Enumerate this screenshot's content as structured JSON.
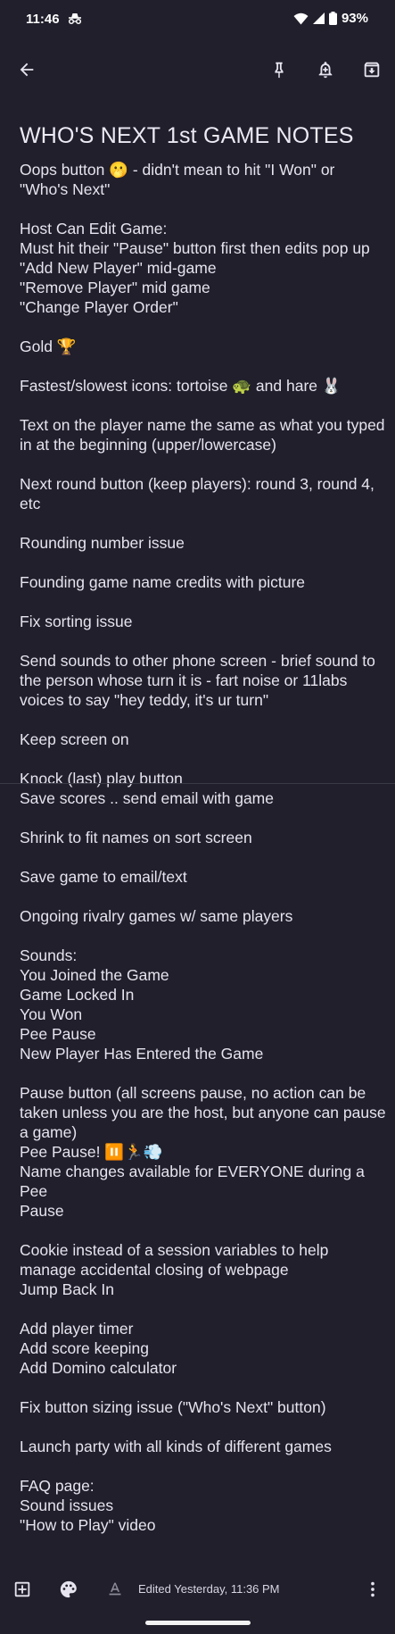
{
  "status": {
    "time": "11:46",
    "battery": "93%"
  },
  "note": {
    "title": "WHO'S NEXT 1st GAME NOTES",
    "blocks": [
      [
        "Oops button 🫢 - didn't mean to hit \"I Won\" or",
        "\"Who's Next\""
      ],
      [
        "Host Can Edit Game:",
        "Must hit their \"Pause\" button first then edits pop up",
        "\"Add New Player\" mid-game",
        "\"Remove Player\" mid game",
        "\"Change Player Order\""
      ],
      [
        "Gold 🏆"
      ],
      [
        "Fastest/slowest icons: tortoise 🐢 and hare 🐰"
      ],
      [
        "Text on the player name the same as what you typed",
        "in at the beginning (upper/lowercase)"
      ],
      [
        "Next round button (keep players): round 3, round 4,",
        "etc"
      ],
      [
        "Rounding number issue"
      ],
      [
        "Founding game name credits with picture"
      ],
      [
        "Fix sorting issue"
      ],
      [
        "Send sounds to other phone screen - brief sound to",
        "the person whose turn it is - fart noise or 11labs",
        "voices to say \"hey teddy, it's ur turn\""
      ],
      [
        "Keep screen on"
      ],
      [
        "Knock (last) play button",
        "Save scores .. send email with game"
      ],
      [
        "Shrink to fit names on sort screen"
      ],
      [
        "Save game to email/text"
      ],
      [
        "Ongoing rivalry games w/ same players"
      ],
      [
        "Sounds:",
        "You Joined the Game",
        "Game Locked In",
        "You Won",
        "Pee Pause",
        "New Player Has Entered the Game"
      ],
      [
        "Pause button (all screens pause, no action can be",
        "taken unless you are the host, but anyone can pause",
        "a game)",
        "Pee Pause! ⏸️🏃💨",
        "Name changes available for EVERYONE during a Pee",
        "Pause"
      ],
      [
        "Cookie instead of a session variables to help",
        "manage accidental closing of webpage",
        "Jump Back In"
      ],
      [
        "Add player timer",
        "Add score keeping",
        "Add Domino calculator"
      ],
      [
        "Fix button sizing issue (\"Who's Next\" button)"
      ],
      [
        "Launch party with all kinds of different games"
      ],
      [
        "FAQ page:",
        "Sound issues",
        "\"How to Play\" video"
      ]
    ]
  },
  "bottom": {
    "edited": "Edited Yesterday, 11:36 PM"
  },
  "icons": {
    "back": "arrow-left-icon",
    "pin": "pin-icon",
    "reminder": "bell-plus-icon",
    "archive": "archive-icon",
    "add": "add-box-icon",
    "palette": "palette-icon",
    "text_format": "text-format-icon",
    "more": "more-vert-icon"
  },
  "colors": {
    "background": "#201f2b",
    "text": "#e6e4ee"
  }
}
